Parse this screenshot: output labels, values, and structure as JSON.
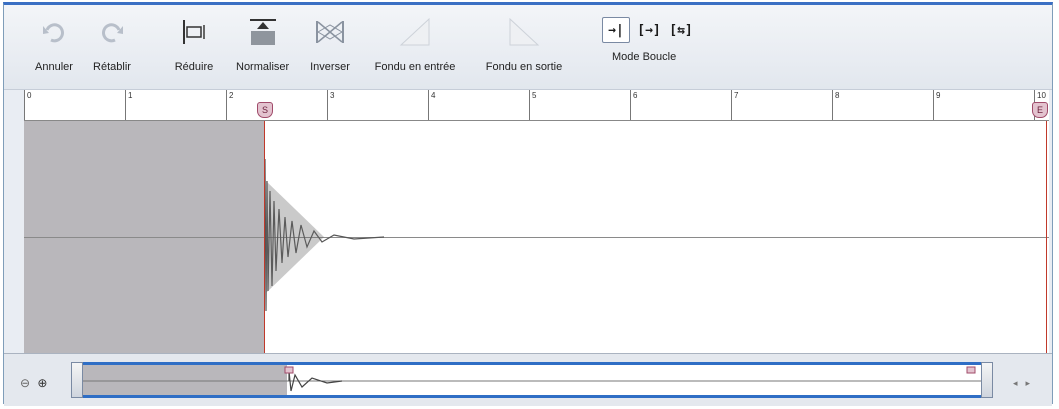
{
  "toolbar": {
    "undo": "Annuler",
    "redo": "Rétablir",
    "trim": "Réduire",
    "normalize": "Normaliser",
    "reverse": "Inverser",
    "fade_in": "Fondu en entrée",
    "fade_out": "Fondu en sortie",
    "loop_mode": "Mode Boucle"
  },
  "loop_buttons": [
    "→|",
    "[→]",
    "[⇆]"
  ],
  "ruler": {
    "ticks": [
      "0",
      "1",
      "2",
      "3",
      "4",
      "5",
      "6",
      "7",
      "8",
      "9",
      "10"
    ]
  },
  "markers": {
    "start": "S",
    "end": "E"
  },
  "zoom": {
    "out": "⊖",
    "in": "⊕"
  },
  "scroll": {
    "left": "◂",
    "right": "▸"
  },
  "colors": {
    "accent": "#2f6ec5",
    "marker": "#c0392b",
    "selection": "#b9b7bb"
  }
}
